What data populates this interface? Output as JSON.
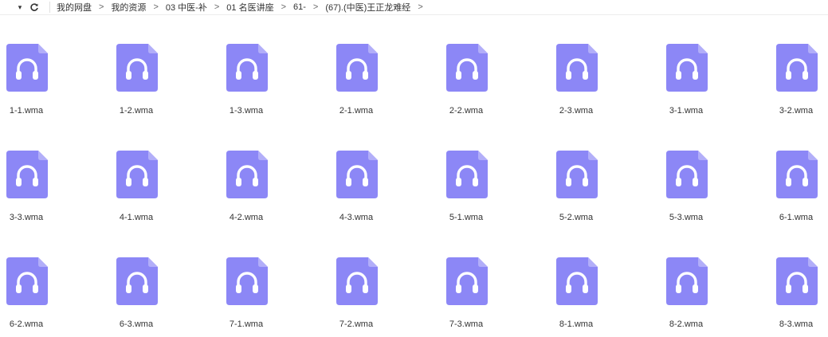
{
  "toolbar": {
    "dropdown_glyph": "▾",
    "refresh_glyph": "C"
  },
  "breadcrumb": [
    "我的网盘",
    "我的资源",
    "03 中医-补",
    "01 名医讲座",
    "61-",
    "(67).(中医)王正龙难经"
  ],
  "breadcrumb_separator": ">",
  "icon": {
    "type": "audio-file-icon",
    "color": "#8c87f6",
    "color_light": "#b2aef9",
    "glyph_color": "#ffffff"
  },
  "files": [
    "1-1.wma",
    "1-2.wma",
    "1-3.wma",
    "2-1.wma",
    "2-2.wma",
    "2-3.wma",
    "3-1.wma",
    "3-2.wma",
    "3-3.wma",
    "4-1.wma",
    "4-2.wma",
    "4-3.wma",
    "5-1.wma",
    "5-2.wma",
    "5-3.wma",
    "6-1.wma",
    "6-2.wma",
    "6-3.wma",
    "7-1.wma",
    "7-2.wma",
    "7-3.wma",
    "8-1.wma",
    "8-2.wma",
    "8-3.wma"
  ]
}
